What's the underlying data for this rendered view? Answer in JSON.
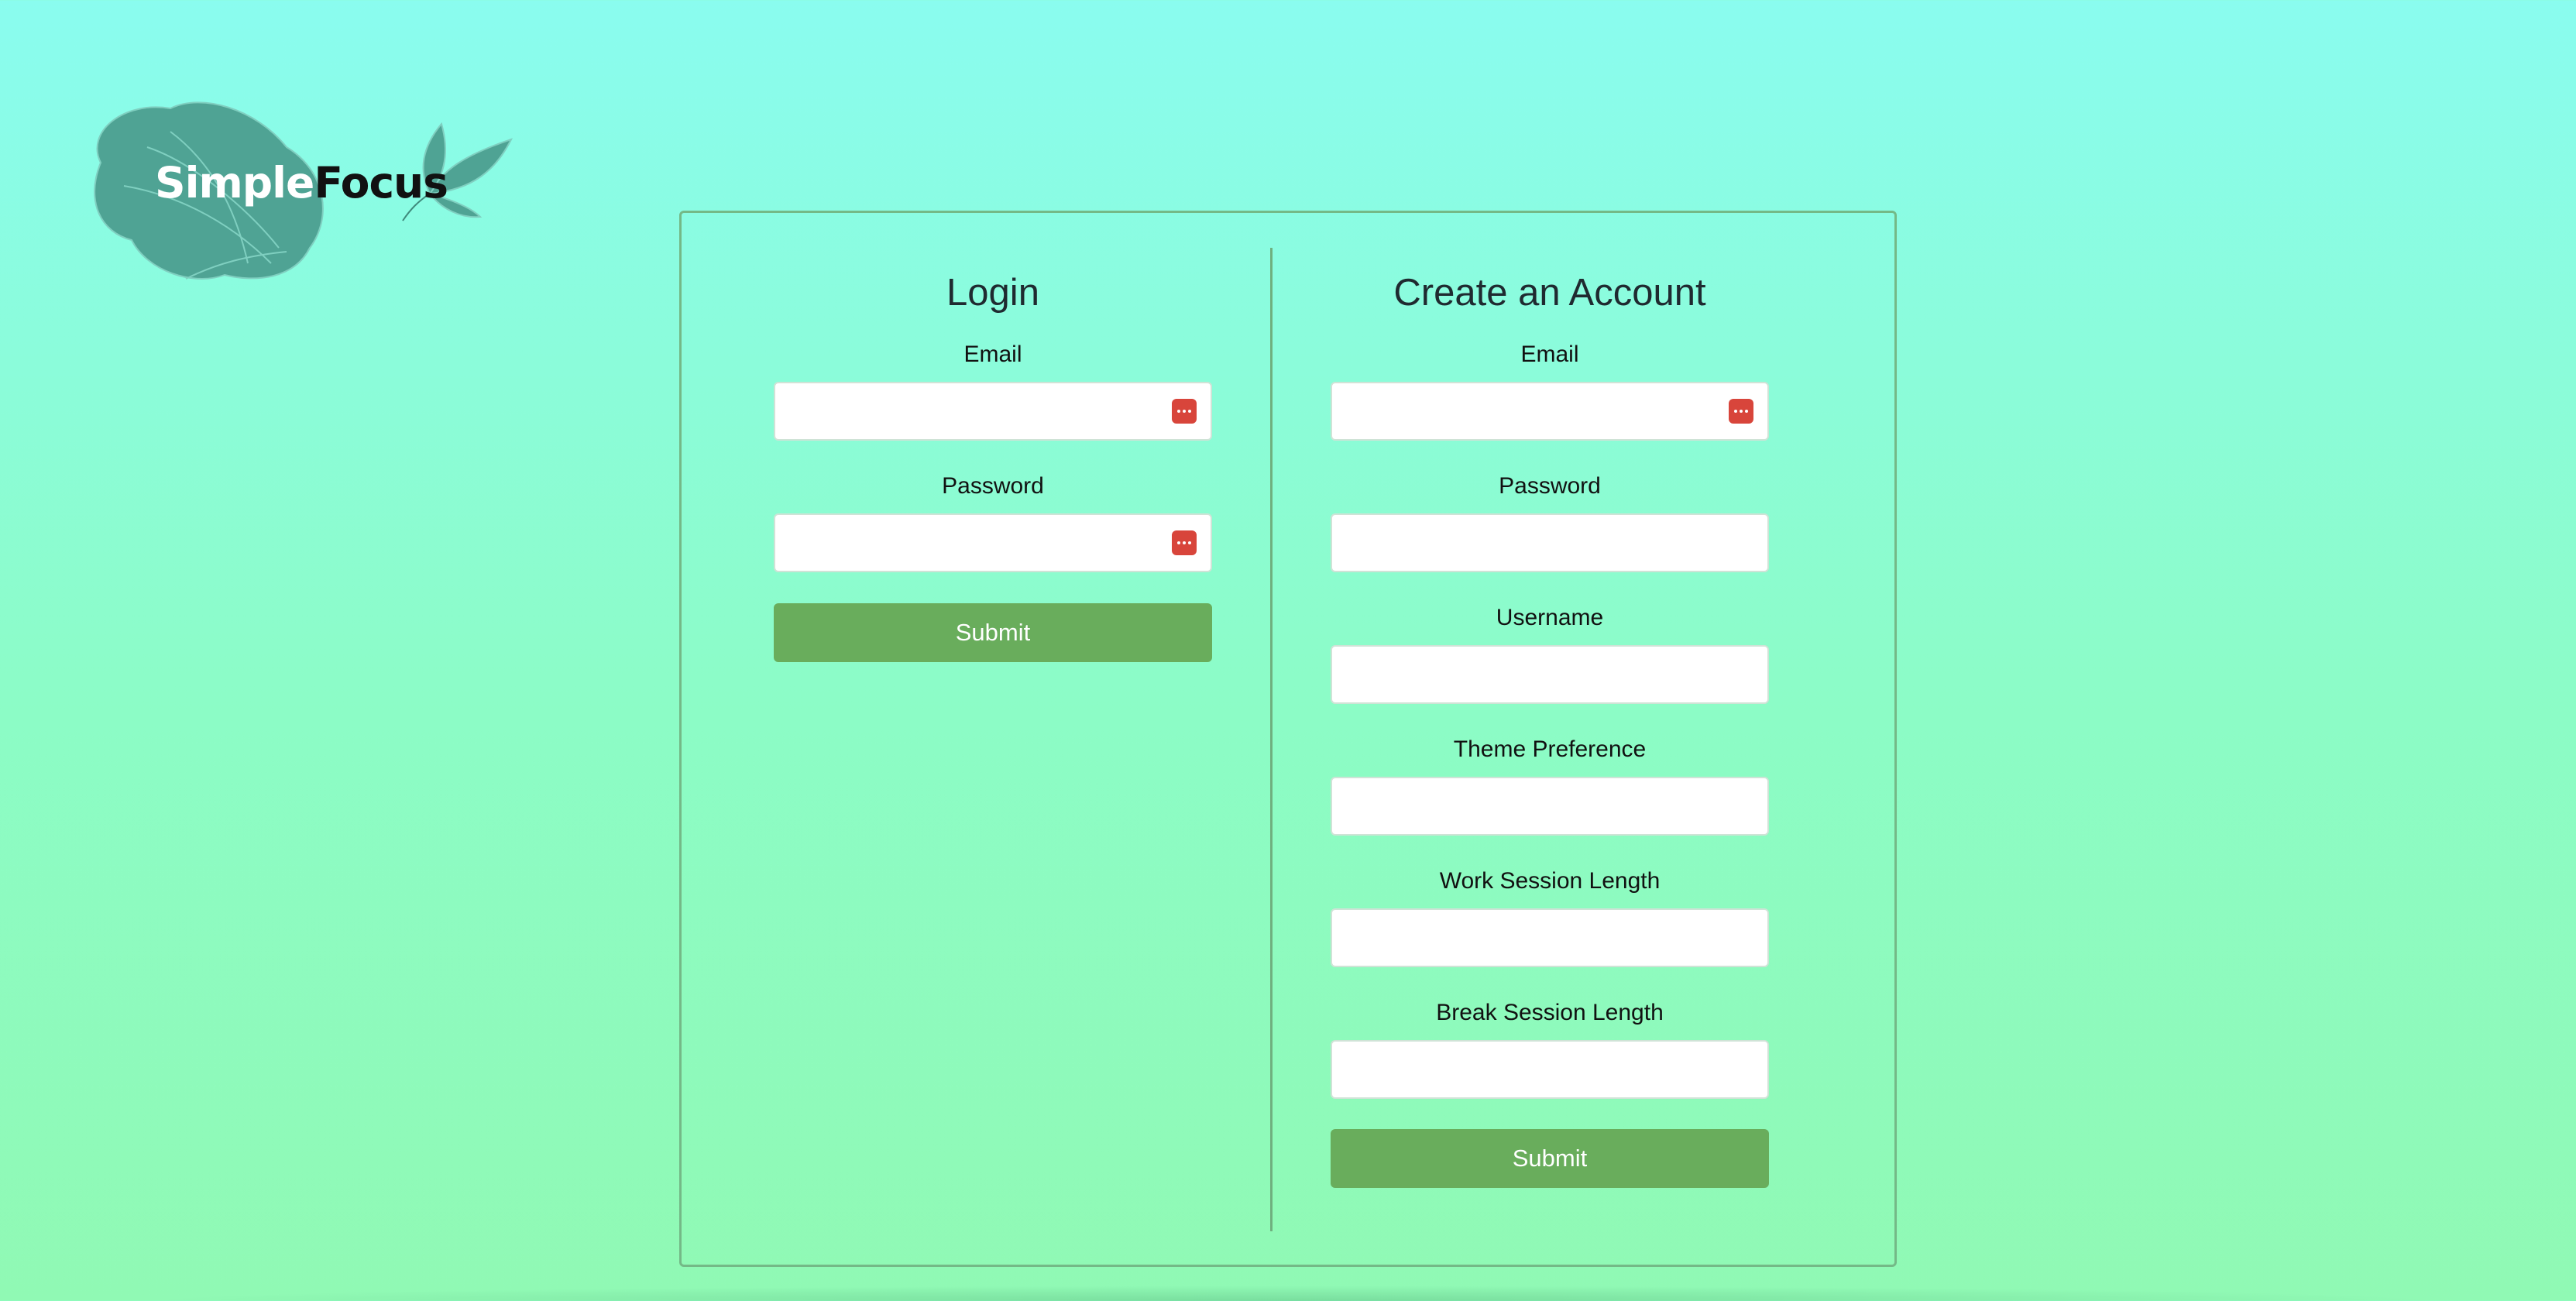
{
  "brand": {
    "name_part1": "Simple",
    "name_part2": "Focus",
    "leaf_color": "#4fa394"
  },
  "login": {
    "title": "Login",
    "email_label": "Email",
    "email_value": "",
    "password_label": "Password",
    "password_value": "",
    "submit_label": "Submit"
  },
  "create_account": {
    "title": "Create an Account",
    "email_label": "Email",
    "email_value": "",
    "password_label": "Password",
    "password_value": "",
    "username_label": "Username",
    "username_value": "",
    "theme_label": "Theme Preference",
    "theme_value": "",
    "work_session_label": "Work Session Length",
    "work_session_value": "",
    "break_session_label": "Break Session Length",
    "break_session_value": "",
    "submit_label": "Submit"
  },
  "icons": {
    "password_manager": "password-manager-icon"
  },
  "colors": {
    "accent_button": "#69ad5c",
    "panel_border": "#74b987",
    "password_manager_icon": "#d8453b"
  }
}
